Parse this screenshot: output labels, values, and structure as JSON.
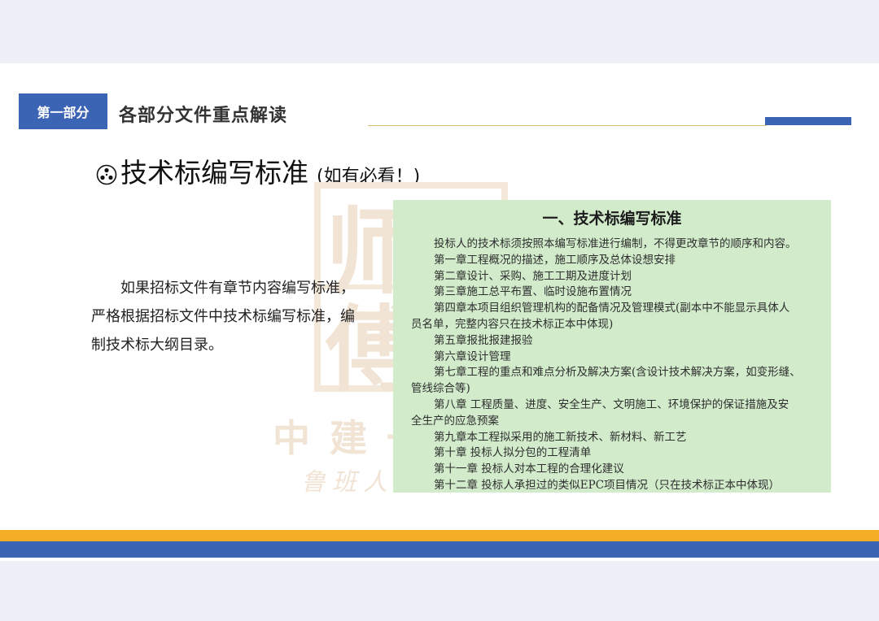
{
  "header": {
    "section_tag": "第一部分",
    "section_title": "各部分文件重点解读",
    "accent_colors": {
      "blue": "#3c64b4",
      "gold": "#f4ae26"
    }
  },
  "subtitle": {
    "icon": "triskelion-circle-icon",
    "main": "技术标编写标准",
    "note": "(如有必看！)"
  },
  "paragraph": "如果招标文件有章节内容编写标准，严格根据招标文件中技术标编写标准，编制技术标大纲目录。",
  "watermark": {
    "seal_chars": [
      "师",
      "傅"
    ],
    "company": "中建一",
    "slogan": "鲁班人"
  },
  "document_excerpt": {
    "title": "一、技术标编写标准",
    "lines": [
      {
        "text": "投标人的技术标须按照本编写标准进行编制，不得更改章节的顺序和内容。",
        "indent": true
      },
      {
        "text": "第一章工程概况的描述，施工顺序及总体设想安排",
        "indent": true
      },
      {
        "text": "第二章设计、采购、施工工期及进度计划",
        "indent": true
      },
      {
        "text": "第三章施工总平布置、临时设施布置情况",
        "indent": true
      },
      {
        "text": "第四章本项目组织管理机构的配备情况及管理模式(副本中不能显示具体人",
        "indent": true
      },
      {
        "text": "员名单，完整内容只在技术标正本中体现)",
        "indent": false
      },
      {
        "text": "第五章报批报建报验",
        "indent": true
      },
      {
        "text": "第六章设计管理",
        "indent": true
      },
      {
        "text": "第七章工程的重点和难点分析及解决方案(含设计技术解决方案，如变形缝、",
        "indent": true
      },
      {
        "text": "管线综合等)",
        "indent": false
      },
      {
        "text": "第八章 工程质量、进度、安全生产、文明施工、环境保护的保证措施及安",
        "indent": true
      },
      {
        "text": "全生产的应急预案",
        "indent": false
      },
      {
        "text": "第九章本工程拟采用的施工新技术、新材料、新工艺",
        "indent": true
      },
      {
        "text": "第十章 投标人拟分包的工程清单",
        "indent": true
      },
      {
        "text": "第十一章 投标人对本工程的合理化建议",
        "indent": true
      },
      {
        "text": "第十二章 投标人承担过的类似EPC项目情况（只在技术标正本中体现）",
        "indent": true
      }
    ]
  }
}
